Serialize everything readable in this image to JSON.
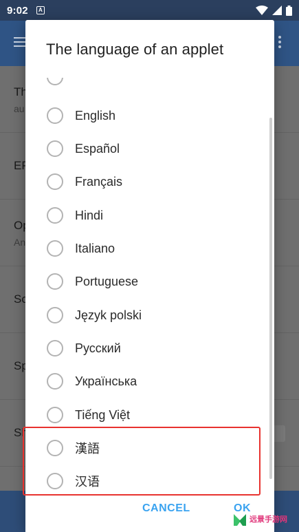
{
  "status_bar": {
    "time": "9:02",
    "notification_icon": "A"
  },
  "background_app": {
    "rows": [
      {
        "title": "Th",
        "subtitle": "au"
      },
      {
        "title": "EP",
        "subtitle": ""
      },
      {
        "title": "Op",
        "subtitle": "An"
      },
      {
        "title": "So",
        "subtitle": ""
      },
      {
        "title": "Sp",
        "subtitle": ""
      },
      {
        "title": "Sh",
        "subtitle": ""
      }
    ]
  },
  "dialog": {
    "title": "The language of an applet",
    "options": [
      {
        "label": "English",
        "selected": false
      },
      {
        "label": "Español",
        "selected": false
      },
      {
        "label": "Français",
        "selected": false
      },
      {
        "label": "Hindi",
        "selected": false
      },
      {
        "label": "Italiano",
        "selected": false
      },
      {
        "label": "Portuguese",
        "selected": false
      },
      {
        "label": "Język polski",
        "selected": false
      },
      {
        "label": "Русский",
        "selected": false
      },
      {
        "label": "Українська",
        "selected": false
      },
      {
        "label": "Tiếng Việt",
        "selected": false
      },
      {
        "label": "漢語",
        "selected": false
      },
      {
        "label": "汉语",
        "selected": false
      }
    ],
    "cancel_label": "CANCEL",
    "ok_label": "OK"
  },
  "watermark": {
    "text": "远景手游网"
  },
  "colors": {
    "accent": "#3aa3f0",
    "highlight": "#e8322f",
    "toolbar": "#2f5485",
    "status_bar": "#2b3f5e"
  }
}
